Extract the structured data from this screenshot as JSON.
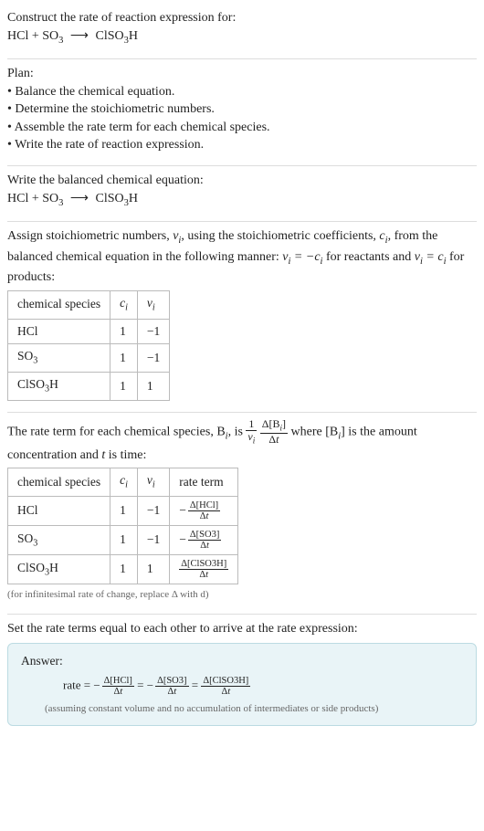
{
  "prompt": {
    "line1": "Construct the rate of reaction expression for:"
  },
  "plan": {
    "heading": "Plan:",
    "b1": "Balance the chemical equation.",
    "b2": "Determine the stoichiometric numbers.",
    "b3": "Assemble the rate term for each chemical species.",
    "b4": "Write the rate of reaction expression."
  },
  "balanced": {
    "intro": "Write the balanced chemical equation:"
  },
  "assign": {
    "text1": "Assign stoichiometric numbers, ",
    "text2": ", using the stoichiometric coefficients, ",
    "text3": ", from the balanced chemical equation in the following manner: ",
    "text4": " for reactants and ",
    "text5": " for products:",
    "hdr_species": "chemical species",
    "row1_sp": "HCl",
    "row1_c": "1",
    "row1_v": "−1",
    "row2_sp": "SO",
    "row2_c": "1",
    "row2_v": "−1",
    "row3_sp": "ClSO",
    "row3_c": "1",
    "row3_v": "1"
  },
  "rateterm": {
    "t1": "The rate term for each chemical species, B",
    "t2": ", is ",
    "t3": " where [B",
    "t4": "] is the amount concentration and ",
    "t5": " is time:",
    "hdr_species": "chemical species",
    "hdr_rate": "rate term",
    "r1_sp": "HCl",
    "r1_c": "1",
    "r1_v": "−1",
    "r2_sp": "SO",
    "r2_c": "1",
    "r2_v": "−1",
    "r3_sp": "ClSO",
    "r3_c": "1",
    "r3_v": "1",
    "foot": "(for infinitesimal rate of change, replace Δ with d)"
  },
  "final": {
    "intro": "Set the rate terms equal to each other to arrive at the rate expression:",
    "answer_label": "Answer:",
    "rate_word": "rate = ",
    "note": "(assuming constant volume and no accumulation of intermediates or side products)"
  },
  "sym": {
    "nu": "ν",
    "ci_c": "c",
    "isub": "i",
    "eq_nc": " = −c",
    "eq_pc": " = c",
    "delta": "Δ",
    "t": "t",
    "arrow": "⟶",
    "hcl": "HCl",
    "plus": " + ",
    "so": "SO",
    "three": "3",
    "clso": "ClSO",
    "h": "H",
    "one_over": "1",
    "dB_num": "Δ[B",
    "dB_close": "]",
    "dHCl": "Δ[HCl]",
    "dSO3": "Δ[SO3]",
    "dClSO3H": "Δ[ClSO3H]",
    "dt": "Δt",
    "minus": "−",
    "eq": " = "
  }
}
